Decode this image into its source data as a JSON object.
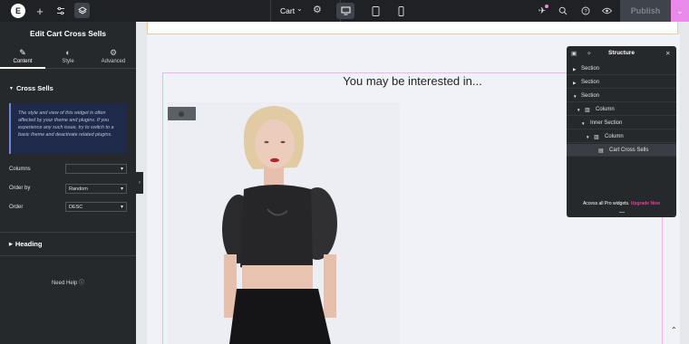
{
  "topbar": {
    "logo_text": "E",
    "page_selector": "Cart",
    "publish_label": "Publish"
  },
  "panel": {
    "title": "Edit Cart Cross Sells",
    "tabs": [
      {
        "label": "Content",
        "icon": "pencil-icon"
      },
      {
        "label": "Style",
        "icon": "half-circle-icon"
      },
      {
        "label": "Advanced",
        "icon": "gear-icon"
      }
    ],
    "cross_sells_heading": "Cross Sells",
    "notice": "The style and view of this widget is often affected by your theme and plugins. If you experience any such issue, try to switch to a basic theme and deactivate related plugins.",
    "fields": [
      {
        "label": "Columns",
        "value": ""
      },
      {
        "label": "Order by",
        "value": "Random"
      },
      {
        "label": "Order",
        "value": "DESC"
      }
    ],
    "heading_section": "Heading",
    "need_help": "Need Help"
  },
  "canvas": {
    "widget_title": "You may be interested in..."
  },
  "structure": {
    "title": "Structure",
    "rows": [
      {
        "label": "Section",
        "depth": 0,
        "arrow": "▶",
        "icon": ""
      },
      {
        "label": "Section",
        "depth": 0,
        "arrow": "▶",
        "icon": ""
      },
      {
        "label": "Section",
        "depth": 0,
        "arrow": "▼",
        "icon": ""
      },
      {
        "label": "Column",
        "depth": 1,
        "arrow": "▼",
        "icon": "column-icon"
      },
      {
        "label": "Inner Section",
        "depth": 2,
        "arrow": "▼",
        "icon": ""
      },
      {
        "label": "Column",
        "depth": 3,
        "arrow": "▼",
        "icon": "column-icon"
      },
      {
        "label": "Cart Cross Sells",
        "depth": 4,
        "arrow": "",
        "icon": "widget-icon"
      }
    ],
    "footer_text": "Access all Pro widgets.",
    "footer_link": "Upgrade Now"
  },
  "colors": {
    "panel_bg": "#26292c",
    "accent": "#e88be8",
    "upgrade_link": "#e33f9c"
  }
}
